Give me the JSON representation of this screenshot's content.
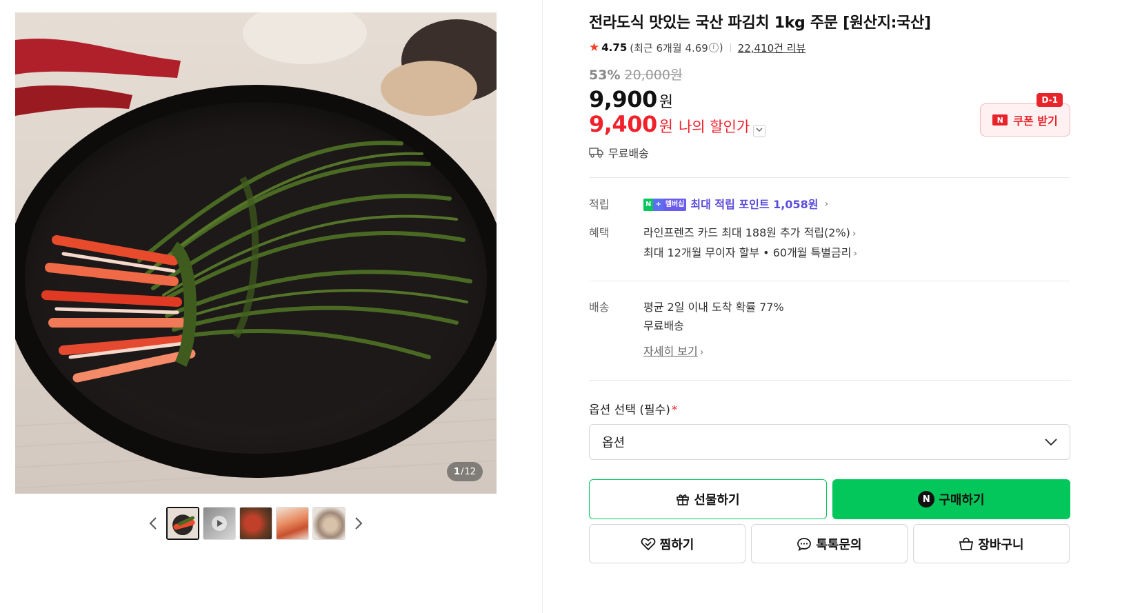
{
  "product": {
    "title": "전라도식 맛있는 국산 파김치 1kg 주문 [원산지:국산]",
    "rating": {
      "score": "4.75",
      "recent_prefix": "(최근 6개월 4.69",
      "recent_suffix": ")",
      "info_icon": "i",
      "reviews": "22,410건 리뷰"
    },
    "discount_rate": "53%",
    "original_price": "20,000원",
    "price": "9,900",
    "price_unit": "원",
    "my_price": "9,400",
    "my_price_unit": "원",
    "my_price_label": "나의 할인가",
    "shipping_summary": "무료배송"
  },
  "coupon": {
    "badge": "D-1",
    "n_mark": "N",
    "label": "쿠폰 받기"
  },
  "benefits": {
    "points_label": "적립",
    "membership_badge": {
      "n": "N",
      "plus": "+",
      "text": "멤버십"
    },
    "points_text": "최대 적립 포인트 1,058원",
    "perks_label": "혜택",
    "perks": [
      "라인프렌즈 카드 최대 188원 추가 적립(2%)",
      "최대 12개월 무이자 할부 • 60개월 특별금리"
    ]
  },
  "delivery": {
    "label": "배송",
    "arrival": "평균 2일 이내 도착 확률 77%",
    "fee": "무료배송",
    "details_link": "자세히 보기"
  },
  "option": {
    "label": "옵션 선택 (필수)",
    "required_mark": "*",
    "placeholder": "옵션"
  },
  "actions": {
    "gift": "선물하기",
    "buy": "구매하기",
    "buy_n_mark": "N",
    "wish": "찜하기",
    "talk": "톡톡문의",
    "cart": "장바구니"
  },
  "gallery": {
    "current": "1",
    "separator": "/",
    "total": "12",
    "thumbnail_count": 5,
    "active_thumbnail": 1
  },
  "icons": {
    "star": "star-icon",
    "truck": "truck-icon",
    "chevron": "chevron-right-icon",
    "dropdown": "chevron-down-icon",
    "gift": "gift-icon",
    "heart": "heart-icon",
    "chat": "chat-icon",
    "cart": "shopping-bag-icon"
  },
  "colors": {
    "accent_red": "#f0212b",
    "naver_green": "#03c75a",
    "membership_purple": "#5a4cdb"
  }
}
